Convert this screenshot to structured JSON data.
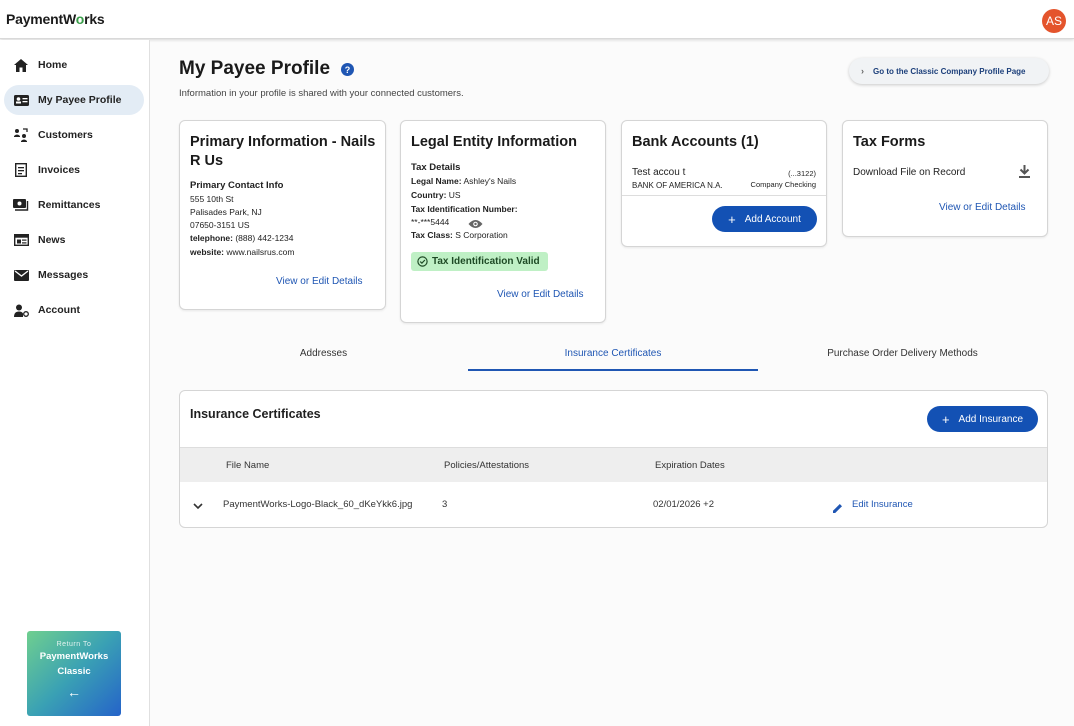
{
  "app": {
    "logo_pre": "PaymentW",
    "logo_o": "o",
    "logo_post": "rks",
    "avatar_initials": "AS"
  },
  "sidebar": {
    "items": [
      {
        "label": "Home",
        "icon": "home-icon"
      },
      {
        "label": "My Payee Profile",
        "icon": "profile-card-icon"
      },
      {
        "label": "Customers",
        "icon": "customers-icon"
      },
      {
        "label": "Invoices",
        "icon": "invoice-icon"
      },
      {
        "label": "Remittances",
        "icon": "remittance-icon"
      },
      {
        "label": "News",
        "icon": "news-icon"
      },
      {
        "label": "Messages",
        "icon": "mail-icon"
      },
      {
        "label": "Account",
        "icon": "account-icon"
      }
    ],
    "classic": {
      "small": "Return To",
      "line1": "PaymentWorks",
      "line2": "Classic"
    }
  },
  "header": {
    "title": "My Payee Profile",
    "subtitle": "Information in your profile is shared with your connected customers.",
    "classic_button": "Go to the Classic Company Profile Page"
  },
  "primary": {
    "title": "Primary Information - Nails R Us",
    "contact_heading": "Primary Contact Info",
    "addr1": "555 10th St",
    "addr2": "Palisades Park, NJ",
    "addr3": "07650-3151 US",
    "tel_label": "telephone:",
    "tel_value": " (888) 442-1234",
    "web_label": "website:",
    "web_value": " www.nailsrus.com",
    "link": "View or Edit Details"
  },
  "legal": {
    "title": "Legal Entity Information",
    "tax_heading": "Tax Details",
    "legal_name_label": "Legal Name:",
    "legal_name_value": " Ashley's Nails",
    "country_label": "Country:",
    "country_value": " US",
    "tin_label": "Tax Identification Number:",
    "tin_value": "**-***5444",
    "tax_class_label": "Tax Class:",
    "tax_class_value": " S Corporation",
    "badge": "Tax Identification Valid",
    "link": "View or Edit Details"
  },
  "bank": {
    "title": "Bank Accounts (1)",
    "account_name": "Test accou t",
    "account_mask": "(...3122)",
    "bank_name": "BANK OF AMERICA N.A.",
    "account_type": "Company Checking",
    "add_button": "Add Account"
  },
  "tax_forms": {
    "title": "Tax Forms",
    "download": "Download File on Record",
    "link": "View or Edit Details"
  },
  "tabs": [
    "Addresses",
    "Insurance Certificates",
    "Purchase Order Delivery Methods"
  ],
  "insurance": {
    "title": "Insurance Certificates",
    "add_button": "Add Insurance",
    "columns": [
      "File Name",
      "Policies/Attestations",
      "Expiration Dates"
    ],
    "rows": [
      {
        "file": "PaymentWorks-Logo-Black_60_dKeYkk6.jpg",
        "policies": "3",
        "expiration": "02/01/2026 +2",
        "action": "Edit Insurance"
      }
    ]
  }
}
